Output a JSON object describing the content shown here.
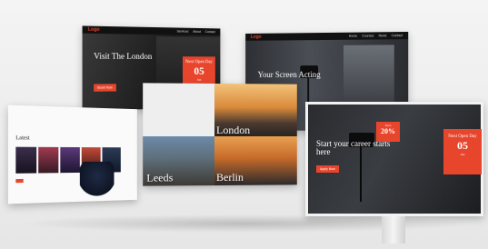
{
  "panel_a": {
    "logo": "Logo",
    "nav": [
      "Services",
      "About",
      "Contact"
    ],
    "hero_title": "Visit The London",
    "cta": "Book Now",
    "promo": {
      "line1": "Next Open Day",
      "value": "05",
      "line2": "Jun"
    }
  },
  "panel_b": {
    "logo": "Logo",
    "nav": [
      "Home",
      "Courses",
      "News",
      "Contact"
    ],
    "hero_title": "Your Screen Acting"
  },
  "panel_c": {
    "heading": "Latest"
  },
  "panel_d": {
    "city_1": "London",
    "city_2": "Leeds",
    "city_3": "Berlin"
  },
  "panel_e": {
    "hero_title": "Start your career starts here",
    "cta": "Apply Now",
    "badge": {
      "line1": "Save",
      "value": "20%"
    },
    "promo": {
      "line1": "Next Open Day",
      "value": "05",
      "line2": "Jun"
    }
  },
  "colors": {
    "accent": "#e8452d",
    "dark": "#111111"
  }
}
